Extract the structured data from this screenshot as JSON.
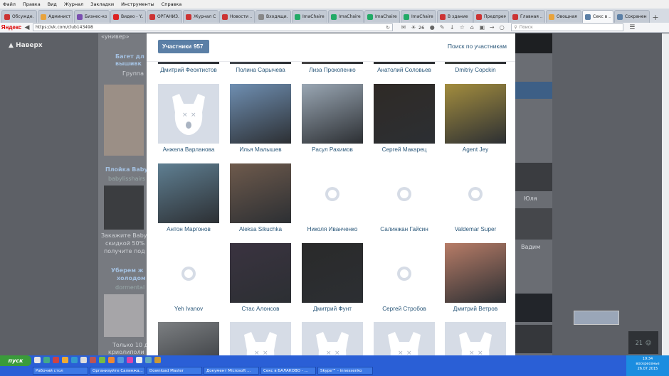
{
  "browser": {
    "menu": [
      "Файл",
      "Правка",
      "Вид",
      "Журнал",
      "Закладки",
      "Инструменты",
      "Справка"
    ],
    "tabs": [
      {
        "label": "Обсужде...",
        "color": "#c33"
      },
      {
        "label": "Админист...",
        "color": "#e8a33c"
      },
      {
        "label": "Бизнес-кос",
        "color": "#7a4fb0"
      },
      {
        "label": "Видео - Y...",
        "color": "#d22"
      },
      {
        "label": "ОРГАНИЗ...",
        "color": "#c33"
      },
      {
        "label": "Журнал С...",
        "color": "#c33"
      },
      {
        "label": "Новости ...",
        "color": "#c33"
      },
      {
        "label": "Входящи...",
        "color": "#888"
      },
      {
        "label": "ImaChaire...",
        "color": "#2a6"
      },
      {
        "label": "ImaChaire...",
        "color": "#2a6"
      },
      {
        "label": "ImaChaire...",
        "color": "#2a6"
      },
      {
        "label": "ImaChaire...",
        "color": "#2a6"
      },
      {
        "label": "В здание",
        "color": "#c33"
      },
      {
        "label": "Предпрем...",
        "color": "#c33"
      },
      {
        "label": "Главная ...",
        "color": "#c33"
      },
      {
        "label": "Овощная ...",
        "color": "#e8a33c"
      },
      {
        "label": "Секс в ...",
        "color": "#5b7fa6",
        "active": true
      },
      {
        "label": "Сохранени...",
        "color": "#5b7fa6"
      }
    ],
    "yandex_logo": "Яндекс",
    "url": "https://vk.com/club143498",
    "weather": "26",
    "search_placeholder": "Поиск"
  },
  "page": {
    "back_to_top": "Наверх",
    "left_col": {
      "top_text": "«универ»",
      "ad1_title": "Багет дл",
      "ad1_title2": "вышивк",
      "ad1_sub": "Группа",
      "ad2_title": "Плойка Baby",
      "ad2_sub": "babylisshairs",
      "ad2_text1": "Закажите Baby",
      "ad2_text2": "скидкой 50%",
      "ad2_text3": "получите под",
      "ad3_title": "Уберем ж",
      "ad3_title2": "холодом",
      "ad3_sub": "dormental",
      "ad3_text1": "Только 10 д",
      "ad3_text2": "криолиполи"
    },
    "right_col": {
      "name1": "Юля",
      "name2": "Вадим",
      "count": "21"
    }
  },
  "modal": {
    "members_label": "Участники",
    "members_count": "957",
    "search_link": "Поиск по участникам",
    "rows": [
      [
        {
          "name": "Дмитрий Феоктистов",
          "avatar": "photo"
        },
        {
          "name": "Полина Сарычева",
          "avatar": "photo"
        },
        {
          "name": "Лиза Прокопенко",
          "avatar": "photo"
        },
        {
          "name": "Анатолий Соловьев",
          "avatar": "photo"
        },
        {
          "name": "Dmitriy Copckin",
          "avatar": "photo"
        }
      ],
      [
        {
          "name": "Анжела Варланова",
          "avatar": "dog"
        },
        {
          "name": "Илья Малышев",
          "avatar": "photo"
        },
        {
          "name": "Расул Рахимов",
          "avatar": "photo"
        },
        {
          "name": "Сергей Макарец",
          "avatar": "photo"
        },
        {
          "name": "Agent Jey",
          "avatar": "photo"
        }
      ],
      [
        {
          "name": "Антон Маргонов",
          "avatar": "photo"
        },
        {
          "name": "Aleksa Sikuchka",
          "avatar": "photo"
        },
        {
          "name": "Николя Иванченко",
          "avatar": "camera"
        },
        {
          "name": "Салинжан Гайсин",
          "avatar": "camera"
        },
        {
          "name": "Valdemar Super",
          "avatar": "camera"
        }
      ],
      [
        {
          "name": "Yeh Ivanov",
          "avatar": "camera"
        },
        {
          "name": "Стас Алонсов",
          "avatar": "photo"
        },
        {
          "name": "Дмитрий Фунт",
          "avatar": "photo"
        },
        {
          "name": "Сергей Стробов",
          "avatar": "camera"
        },
        {
          "name": "Дмитрий Ветров",
          "avatar": "photo"
        }
      ],
      [
        {
          "name": "",
          "avatar": "photo"
        },
        {
          "name": "",
          "avatar": "dog"
        },
        {
          "name": "",
          "avatar": "dog"
        },
        {
          "name": "",
          "avatar": "dog"
        },
        {
          "name": "",
          "avatar": "dog"
        }
      ]
    ]
  },
  "taskbar": {
    "start": "пуск",
    "tasks": [
      "Рабочий стол",
      "Организуйте Салинжа...",
      "Download Master",
      "Документ Microsoft ...",
      "Секс в БАЛАКОВО - ...",
      "Skype™ - innessenko"
    ],
    "time": "19:34",
    "day": "воскресенье",
    "date": "26.07.2015"
  },
  "colors": {
    "link": "#2b587a",
    "members_button": "#5b7fa6",
    "placeholder_bg": "#d6dce6",
    "overlay": "#5d6066",
    "taskbar": "#2a5fd6"
  }
}
